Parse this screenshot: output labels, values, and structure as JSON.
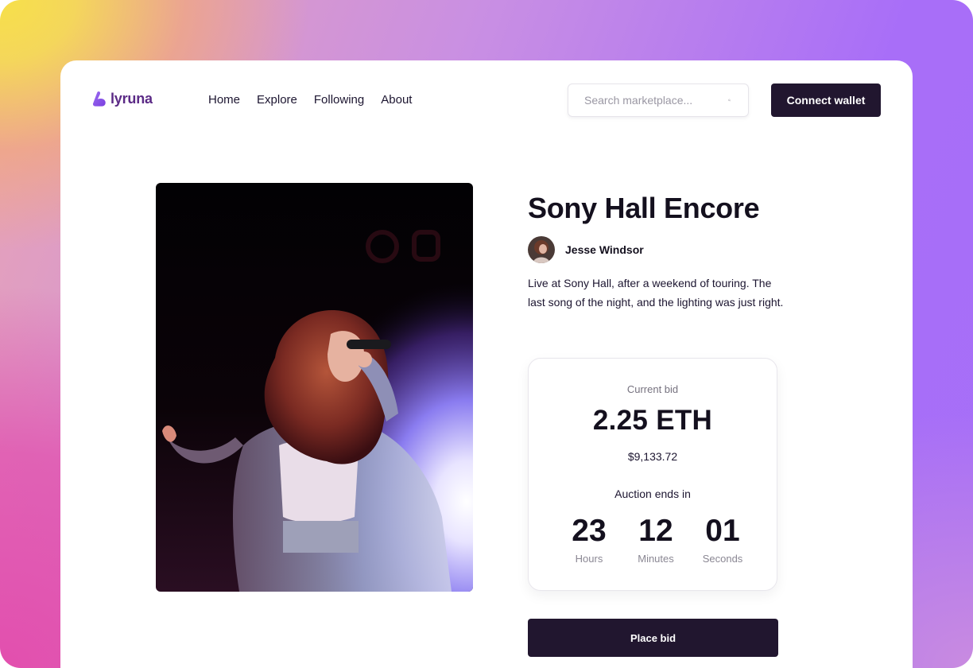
{
  "brand": {
    "name": "lyruna",
    "color": "#5b2a86",
    "icon": "lyruna-logo-icon"
  },
  "nav": {
    "items": [
      {
        "label": "Home"
      },
      {
        "label": "Explore"
      },
      {
        "label": "Following"
      },
      {
        "label": "About"
      }
    ]
  },
  "search": {
    "placeholder": "Search marketplace...",
    "value": "",
    "icon": "search-icon"
  },
  "header": {
    "connect_label": "Connect wallet"
  },
  "artwork": {
    "image": "concert-singer-photo",
    "title": "Sony Hall Encore",
    "creator": {
      "name": "Jesse Windsor",
      "avatar": "creator-avatar"
    },
    "description": "Live at Sony Hall, after a weekend of touring. The last song of the night, and the lighting was just right."
  },
  "bid": {
    "label": "Current bid",
    "amount": "2.25 ETH",
    "usd": "$9,133.72",
    "auction_label": "Auction ends in",
    "countdown": [
      {
        "value": "23",
        "unit": "Hours"
      },
      {
        "value": "12",
        "unit": "Minutes"
      },
      {
        "value": "01",
        "unit": "Seconds"
      }
    ],
    "button_label": "Place bid"
  },
  "colors": {
    "dark_button": "#21162f",
    "text_primary": "#14101e",
    "text_muted": "#76727f"
  }
}
